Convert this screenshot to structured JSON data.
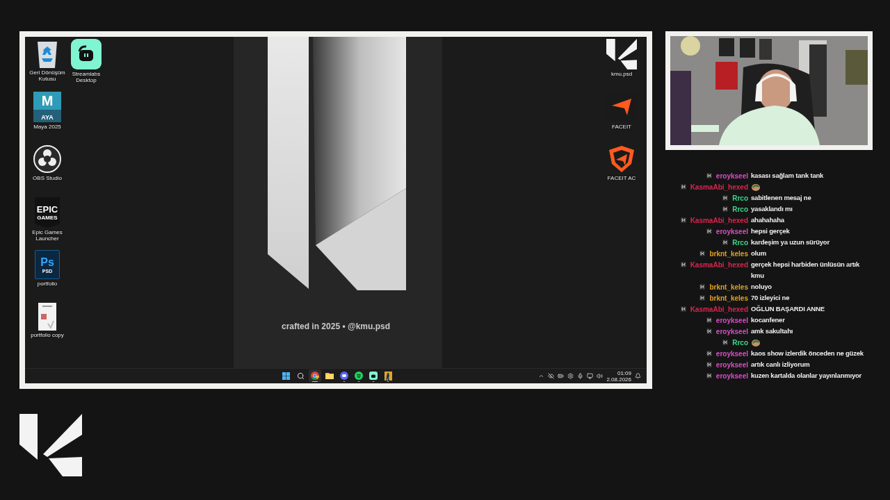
{
  "desktop": {
    "icons_left": [
      {
        "kind": "recycle-bin",
        "label": "Geri Dönüşüm Kutusu"
      },
      {
        "kind": "maya",
        "label": "Maya 2025",
        "glyph": "M",
        "sub": "AYA"
      },
      {
        "kind": "obs",
        "label": "OBS Studio"
      },
      {
        "kind": "epic",
        "label": "Epic Games Launcher",
        "glyph": "EPIC",
        "sub": "GAMES"
      },
      {
        "kind": "photoshop",
        "label": "portfolio",
        "glyph": "Ps",
        "sub": "PSD"
      },
      {
        "kind": "document",
        "label": "portfolio copy"
      },
      {
        "kind": "streamlabs",
        "label": "Streamlabs Desktop"
      }
    ],
    "icons_right": [
      {
        "kind": "kmu",
        "label": "kmu.psd"
      },
      {
        "kind": "faceit",
        "label": "FACEIT"
      },
      {
        "kind": "faceit-ac",
        "label": "FACEIT AC"
      }
    ],
    "wallpaper_caption": "crafted in 2025 • @kmu.psd",
    "taskbar": {
      "apps": [
        {
          "kind": "start",
          "running": false,
          "active": false
        },
        {
          "kind": "search",
          "running": false,
          "active": false
        },
        {
          "kind": "chrome",
          "running": true,
          "active": true
        },
        {
          "kind": "folder",
          "running": false,
          "active": false
        },
        {
          "kind": "discord",
          "running": true,
          "active": false
        },
        {
          "kind": "spotify",
          "running": true,
          "active": false
        },
        {
          "kind": "streamlabs",
          "running": true,
          "active": false
        },
        {
          "kind": "game",
          "running": true,
          "active": false
        }
      ],
      "time": "01:09",
      "date": "2.08.2026"
    }
  },
  "chat": {
    "messages": [
      {
        "user": "eroykseel",
        "color": "#d84fc4",
        "text": "kasası sağlam tank tank"
      },
      {
        "user": "KasmaAbi_hexed",
        "color": "#d9264f",
        "kind": "emote"
      },
      {
        "user": "Rrco",
        "color": "#3ed68c",
        "text": "sabitlenen mesaj ne"
      },
      {
        "user": "Rrco",
        "color": "#3ed68c",
        "text": "yasaklandı mı"
      },
      {
        "user": "KasmaAbi_hexed",
        "color": "#d9264f",
        "text": "ahahahaha"
      },
      {
        "user": "eroykseel",
        "color": "#d84fc4",
        "text": "hepsi gerçek"
      },
      {
        "user": "Rrco",
        "color": "#3ed68c",
        "text": "kardeşim ya uzun sürüyor"
      },
      {
        "user": "brknt_keles",
        "color": "#e0a224",
        "text": "olum"
      },
      {
        "user": "KasmaAbi_hexed",
        "color": "#d9264f",
        "text": "gerçek hepsi harbiden ünlüsün artık kmu"
      },
      {
        "user": "brknt_keles",
        "color": "#e0a224",
        "text": "noluyo"
      },
      {
        "user": "brknt_keles",
        "color": "#e0a224",
        "text": "70 izleyici ne"
      },
      {
        "user": "KasmaAbi_hexed",
        "color": "#d9264f",
        "text": "OĞLUN BAŞARDI ANNE"
      },
      {
        "user": "eroykseel",
        "color": "#d84fc4",
        "text": "kocanfener"
      },
      {
        "user": "eroykseel",
        "color": "#d84fc4",
        "text": "amk sakultahı"
      },
      {
        "user": "Rrco",
        "color": "#3ed68c",
        "kind": "emote"
      },
      {
        "user": "eroykseel",
        "color": "#d84fc4",
        "text": "kaos show izlerdik önceden ne güzek"
      },
      {
        "user": "eroykseel",
        "color": "#d84fc4",
        "text": "artık canlı izliyorum"
      },
      {
        "user": "eroykseel",
        "color": "#d84fc4",
        "text": "kuzen kartalda olanlar yayınlanmıyor"
      }
    ]
  }
}
